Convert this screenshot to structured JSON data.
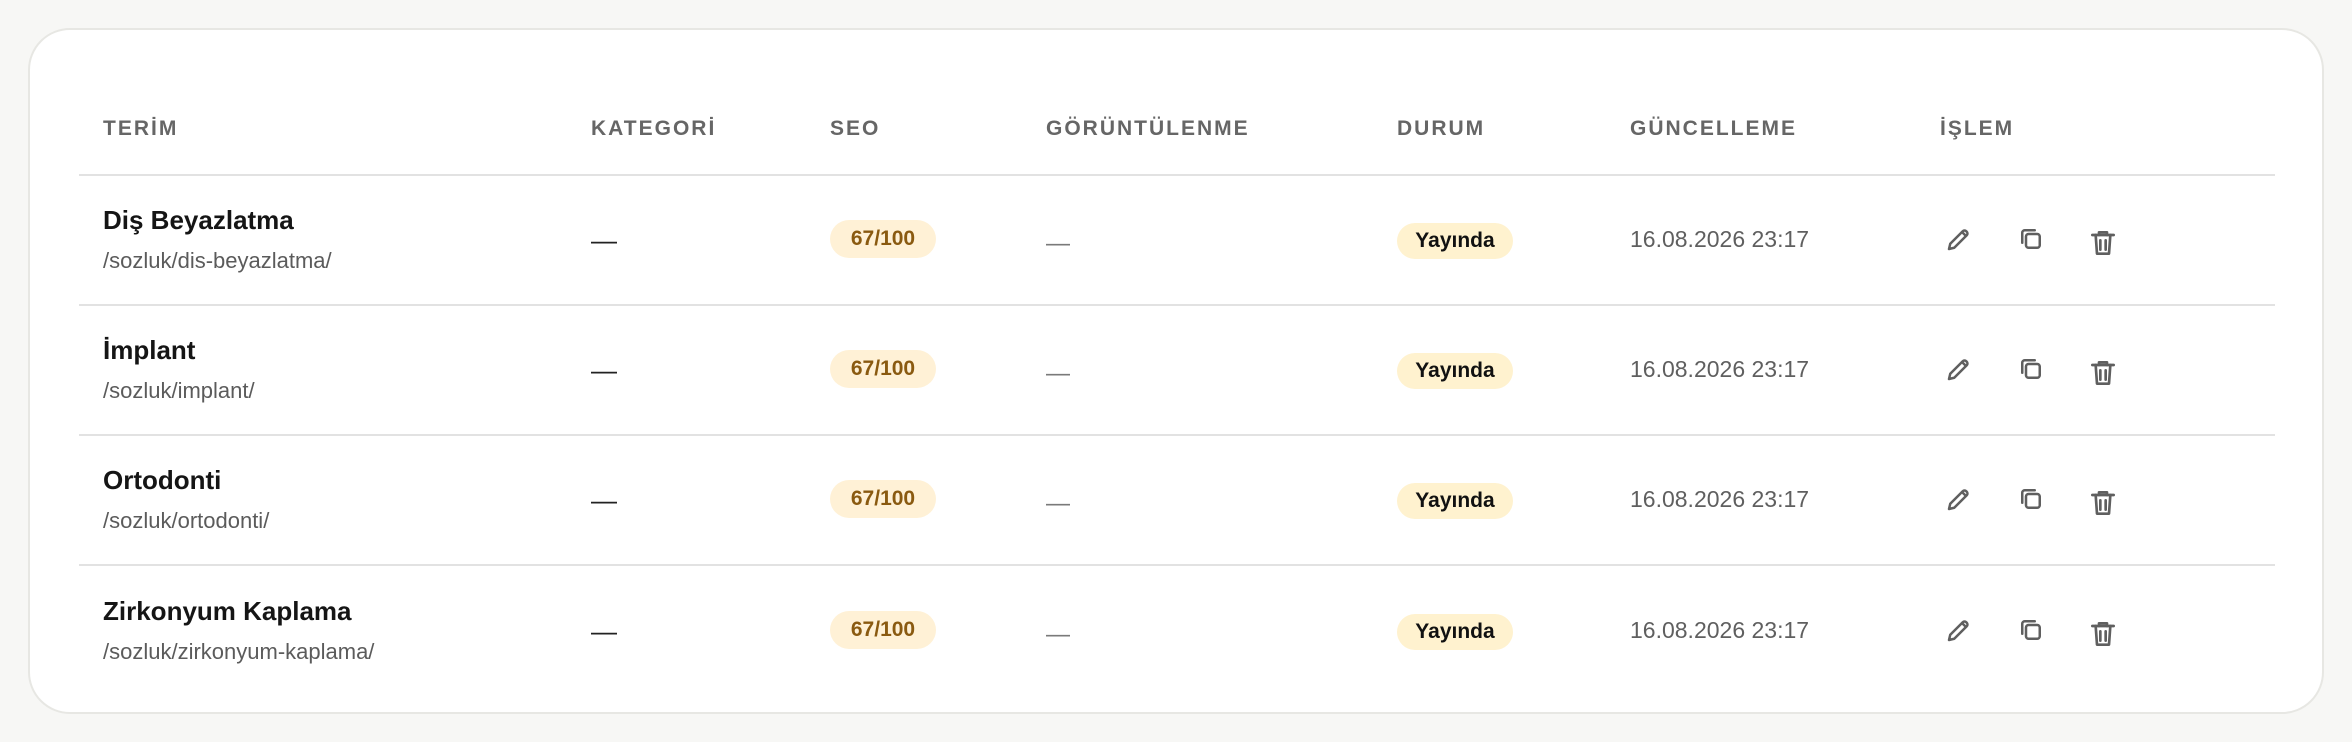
{
  "table": {
    "headers": {
      "term": "TERİM",
      "category": "KATEGORİ",
      "seo": "SEO",
      "views": "GÖRÜNTÜLENME",
      "status": "DURUM",
      "updated": "GÜNCELLEME",
      "actions": "İŞLEM"
    },
    "rows": [
      {
        "title": "Diş Beyazlatma",
        "slug": "/sozluk/dis-beyazlatma/",
        "category": "—",
        "seo": "67/100",
        "views": "—",
        "status": "Yayında",
        "updated": "16.08.2026 23:17"
      },
      {
        "title": "İmplant",
        "slug": "/sozluk/implant/",
        "category": "—",
        "seo": "67/100",
        "views": "—",
        "status": "Yayında",
        "updated": "16.08.2026 23:17"
      },
      {
        "title": "Ortodonti",
        "slug": "/sozluk/ortodonti/",
        "category": "—",
        "seo": "67/100",
        "views": "—",
        "status": "Yayında",
        "updated": "16.08.2026 23:17"
      },
      {
        "title": "Zirkonyum Kaplama",
        "slug": "/sozluk/zirkonyum-kaplama/",
        "category": "—",
        "seo": "67/100",
        "views": "—",
        "status": "Yayında",
        "updated": "16.08.2026 23:17"
      }
    ]
  },
  "icons": {
    "edit": "pencil-icon",
    "duplicate": "copy-icon",
    "delete": "trash-icon"
  },
  "colors": {
    "seo_badge_bg": "#fff1d6",
    "seo_badge_text": "#8a5a10",
    "status_badge_bg": "#fff2cf"
  }
}
